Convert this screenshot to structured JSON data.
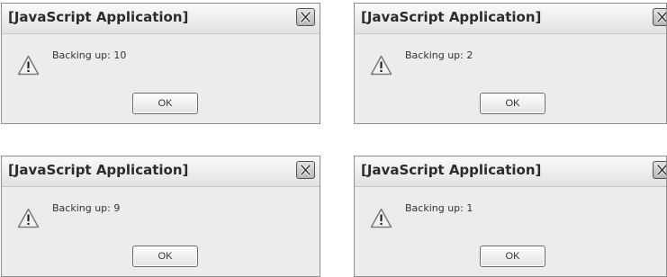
{
  "dialogs": [
    {
      "title": "[JavaScript Application]",
      "message": "Backing up: 10",
      "ok_label": "OK",
      "icon": "warning-icon",
      "close_icon": "close-icon"
    },
    {
      "title": "[JavaScript Application]",
      "message": "Backing up: 2",
      "ok_label": "OK",
      "icon": "warning-icon",
      "close_icon": "close-icon"
    },
    {
      "title": "[JavaScript Application]",
      "message": "Backing up: 9",
      "ok_label": "OK",
      "icon": "warning-icon",
      "close_icon": "close-icon"
    },
    {
      "title": "[JavaScript Application]",
      "message": "Backing up: 1",
      "ok_label": "OK",
      "icon": "warning-icon",
      "close_icon": "close-icon"
    }
  ],
  "colors": {
    "dialog_background": "#ececec",
    "border": "#8e8e8e",
    "text": "#333333"
  }
}
